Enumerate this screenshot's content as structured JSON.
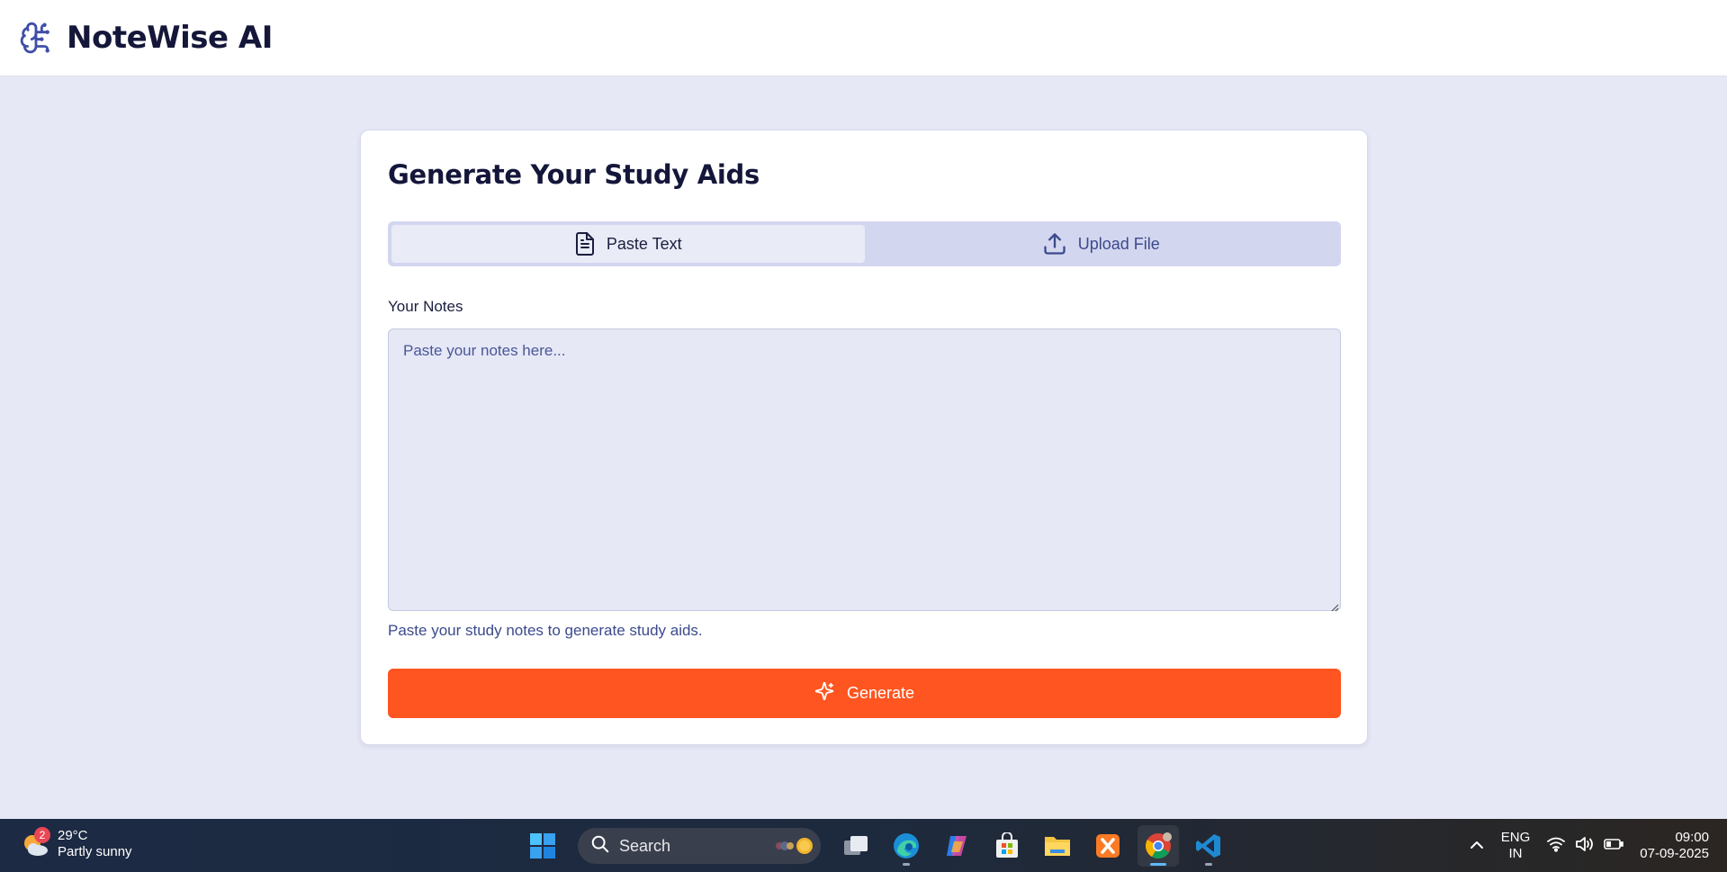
{
  "app": {
    "title": "NoteWise AI"
  },
  "card": {
    "title": "Generate Your Study Aids",
    "tabs": [
      {
        "label": "Paste Text",
        "icon": "document-icon",
        "active": true
      },
      {
        "label": "Upload File",
        "icon": "upload-icon",
        "active": false
      }
    ],
    "notes_label": "Your Notes",
    "notes_placeholder": "Paste your notes here...",
    "notes_value": "",
    "helper_text": "Paste your study notes to generate study aids.",
    "generate_label": "Generate"
  },
  "taskbar": {
    "weather": {
      "temp": "29°C",
      "condition": "Partly sunny",
      "badge": "2"
    },
    "search_label": "Search",
    "language": {
      "line1": "ENG",
      "line2": "IN"
    },
    "clock": {
      "time": "09:00",
      "date": "07-09-2025"
    },
    "apps": [
      "windows-start-icon",
      "search",
      "task-view-icon",
      "edge-icon",
      "copilot-icon",
      "store-icon",
      "file-explorer-icon",
      "xampp-icon",
      "chrome-icon",
      "vscode-icon"
    ]
  },
  "colors": {
    "accent": "#ff5520",
    "background": "#e6e8f6",
    "tab_bg": "#d3d6ef",
    "brand_icon": "#3f4fa8"
  }
}
